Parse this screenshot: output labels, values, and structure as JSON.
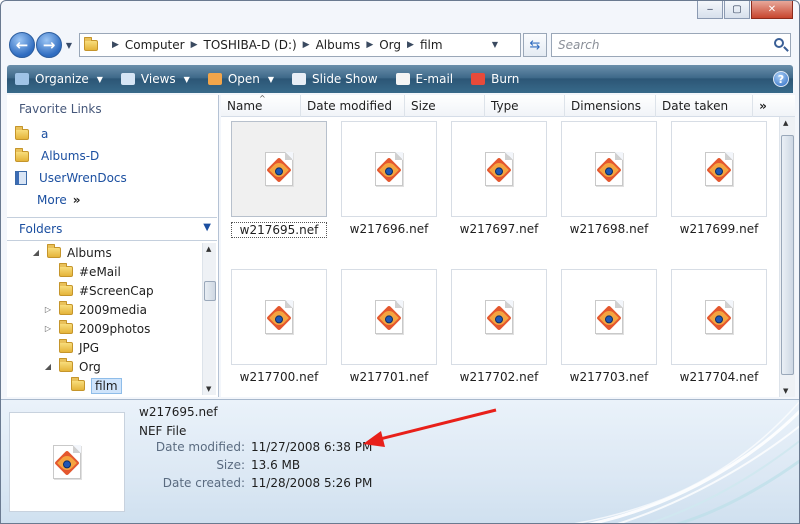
{
  "window": {
    "caption_buttons": {
      "minimize": "‒",
      "maximize": "▢",
      "close": "✕"
    }
  },
  "address": {
    "back_icon": "back-arrow-icon",
    "forward_icon": "forward-arrow-icon",
    "breadcrumbs": [
      "Computer",
      "TOSHIBA-D (D:)",
      "Albums",
      "Org",
      "film"
    ],
    "search_placeholder": "Search"
  },
  "toolbar": {
    "items": [
      {
        "label": "Organize",
        "has_menu": true,
        "icon": "organize-icon"
      },
      {
        "label": "Views",
        "has_menu": true,
        "icon": "views-icon"
      },
      {
        "label": "Open",
        "has_menu": true,
        "icon": "open-icon"
      },
      {
        "label": "Slide Show",
        "has_menu": false,
        "icon": "slideshow-icon"
      },
      {
        "label": "E-mail",
        "has_menu": false,
        "icon": "email-icon"
      },
      {
        "label": "Burn",
        "has_menu": false,
        "icon": "burn-icon"
      }
    ],
    "help": "?"
  },
  "nav": {
    "favorite_links_title": "Favorite Links",
    "favorites": [
      {
        "label": "a",
        "icon": "folder-icon"
      },
      {
        "label": "Albums-D",
        "icon": "folder-icon"
      },
      {
        "label": "UserWrenDocs",
        "icon": "document-icon"
      }
    ],
    "more_label": "More",
    "more_chevron": "»",
    "folders_title": "Folders",
    "tree": [
      {
        "label": "Albums",
        "indent": 1,
        "twisty": "◢",
        "selected": false
      },
      {
        "label": "#eMail",
        "indent": 2,
        "twisty": "",
        "selected": false
      },
      {
        "label": "#ScreenCap",
        "indent": 2,
        "twisty": "",
        "selected": false
      },
      {
        "label": "2009media",
        "indent": 2,
        "twisty": "▷",
        "selected": false
      },
      {
        "label": "2009photos",
        "indent": 2,
        "twisty": "▷",
        "selected": false
      },
      {
        "label": "JPG",
        "indent": 2,
        "twisty": "",
        "selected": false
      },
      {
        "label": "Org",
        "indent": 2,
        "twisty": "◢",
        "selected": false
      },
      {
        "label": "film",
        "indent": 3,
        "twisty": "",
        "selected": true
      }
    ]
  },
  "columns": [
    {
      "label": "Name",
      "sorted": true
    },
    {
      "label": "Date modified",
      "sorted": false
    },
    {
      "label": "Size",
      "sorted": false
    },
    {
      "label": "Type",
      "sorted": false
    },
    {
      "label": "Dimensions",
      "sorted": false
    },
    {
      "label": "Date taken",
      "sorted": false
    }
  ],
  "columns_more": "»",
  "files": [
    {
      "name": "w217695.nef",
      "selected": true
    },
    {
      "name": "w217696.nef",
      "selected": false
    },
    {
      "name": "w217697.nef",
      "selected": false
    },
    {
      "name": "w217698.nef",
      "selected": false
    },
    {
      "name": "w217699.nef",
      "selected": false
    },
    {
      "name": "w217700.nef",
      "selected": false
    },
    {
      "name": "w217701.nef",
      "selected": false
    },
    {
      "name": "w217702.nef",
      "selected": false
    },
    {
      "name": "w217703.nef",
      "selected": false
    },
    {
      "name": "w217704.nef",
      "selected": false
    }
  ],
  "details": {
    "name": "w217695.nef",
    "type": "NEF File",
    "fields": [
      {
        "key": "Date modified:",
        "value": "11/27/2008 6:38 PM"
      },
      {
        "key": "Size:",
        "value": "13.6 MB"
      },
      {
        "key": "Date created:",
        "value": "11/28/2008 5:26 PM"
      }
    ],
    "annotation_color": "#e8201a"
  }
}
